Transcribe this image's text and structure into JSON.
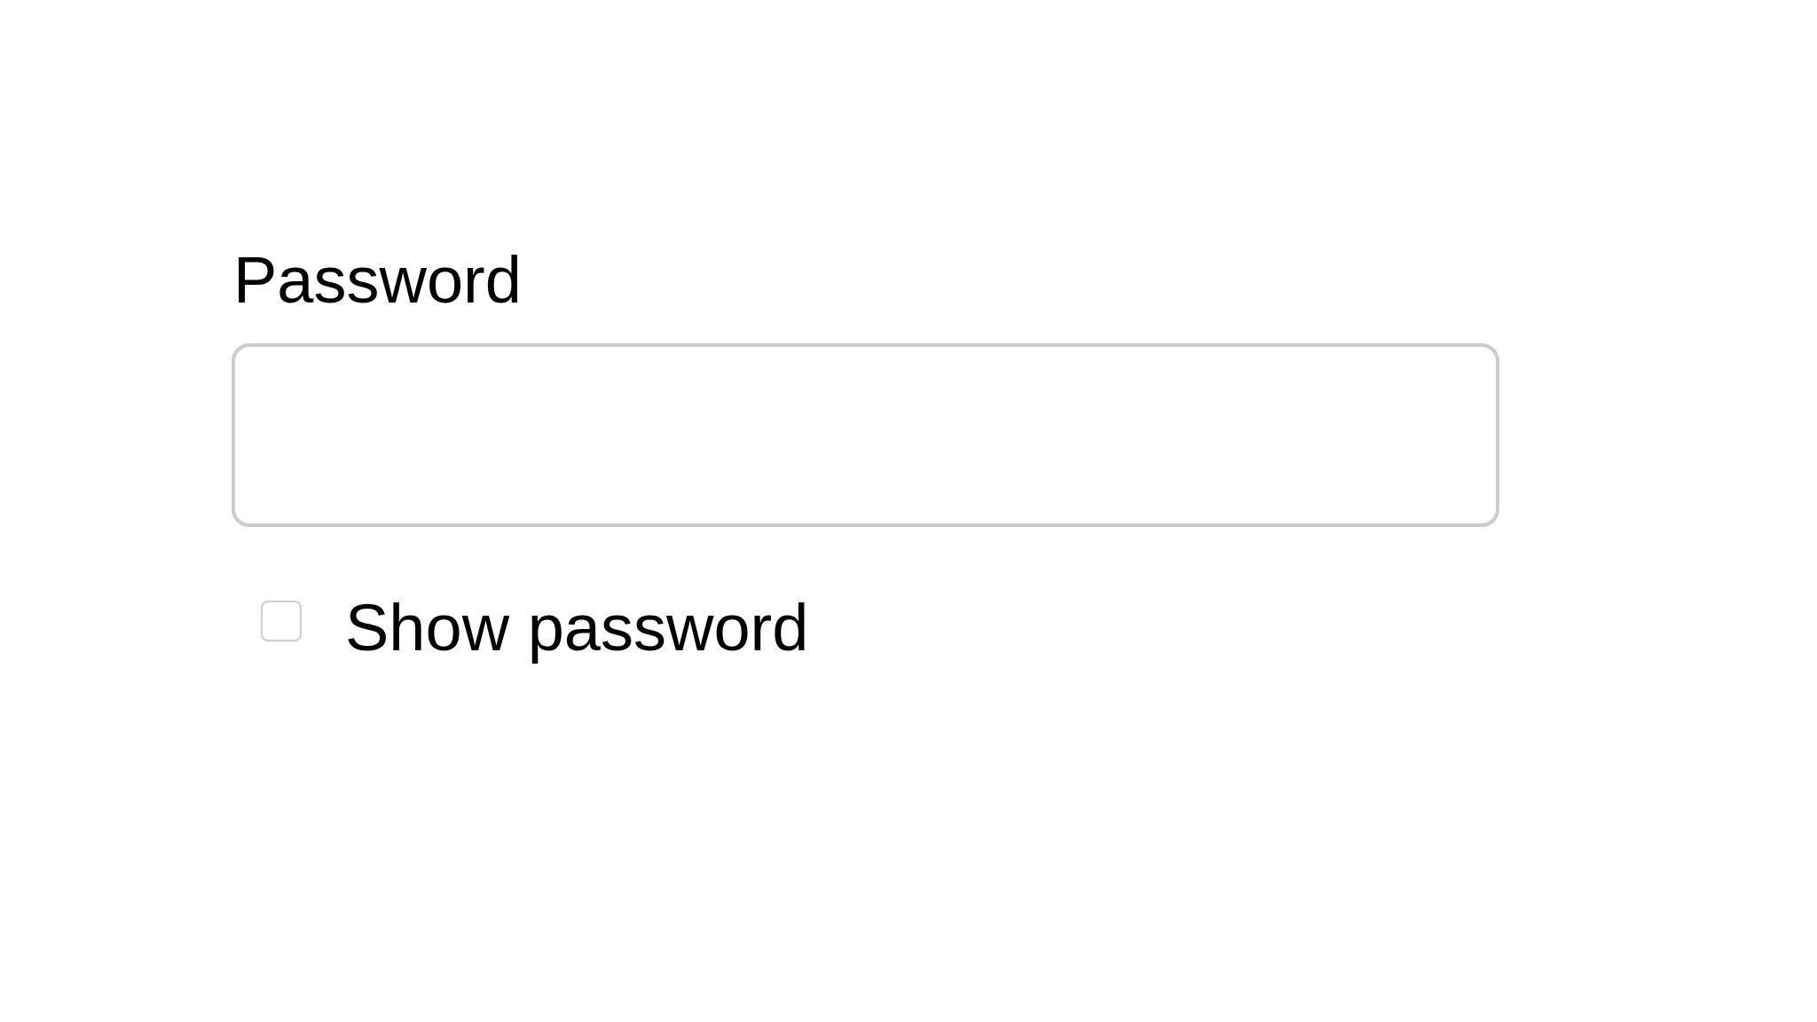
{
  "password_field": {
    "label": "Password"
  },
  "show_password": {
    "label": "Show password",
    "checked": false
  }
}
